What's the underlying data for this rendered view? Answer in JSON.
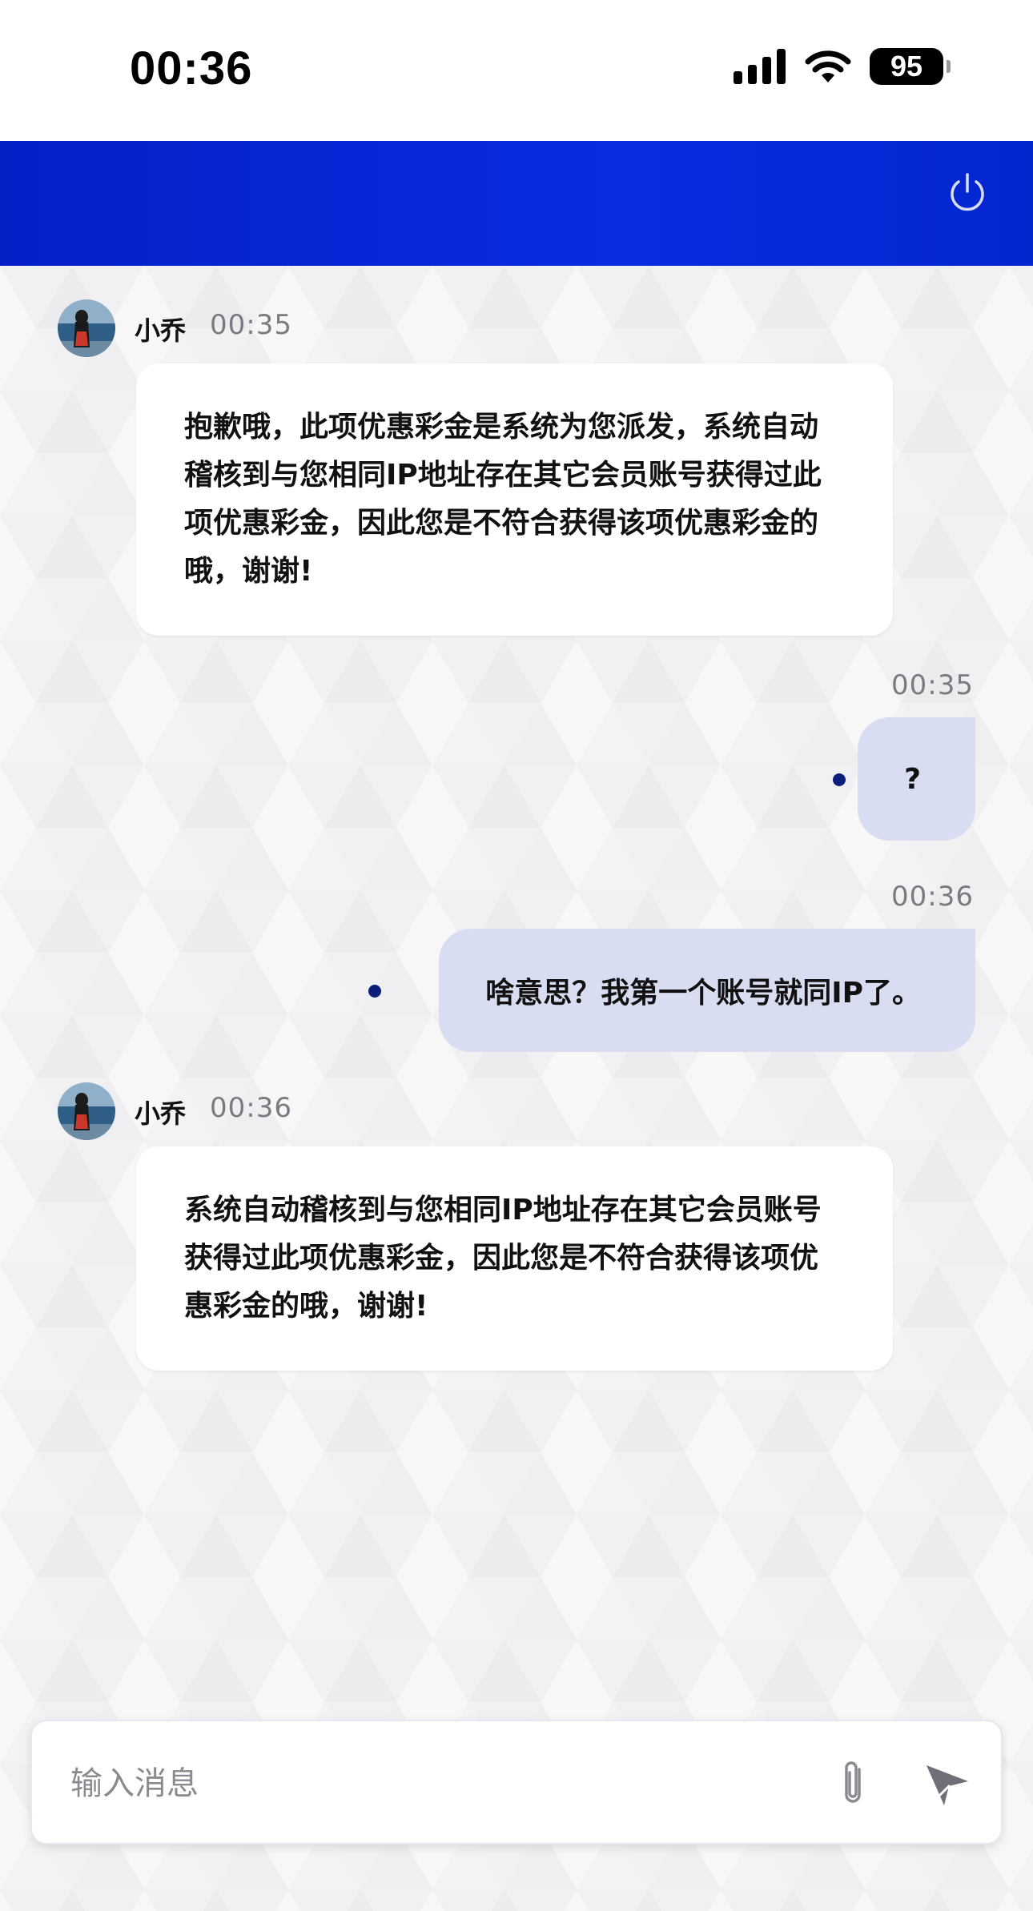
{
  "status_bar": {
    "time": "00:36",
    "battery": "95"
  },
  "header": {
    "power_icon": "power-icon"
  },
  "messages": [
    {
      "sender": "agent",
      "name": "小乔",
      "time": "00:35",
      "text": "抱歉哦，此项优惠彩金是系统为您派发，系统自动稽核到与您相同IP地址存在其它会员账号获得过此项优惠彩金，因此您是不符合获得该项优惠彩金的哦，谢谢!"
    },
    {
      "sender": "user",
      "time": "00:35",
      "text": "?"
    },
    {
      "sender": "user",
      "time": "00:36",
      "text": "啥意思？我第一个账号就同IP了。"
    },
    {
      "sender": "agent",
      "name": "小乔",
      "time": "00:36",
      "text": "系统自动稽核到与您相同IP地址存在其它会员账号获得过此项优惠彩金，因此您是不符合获得该项优惠彩金的哦，谢谢!"
    }
  ],
  "composer": {
    "placeholder": "输入消息",
    "attach_icon": "paperclip-icon",
    "send_icon": "send-icon"
  },
  "colors": {
    "header_blue": "#0a2be0",
    "user_bubble": "#d9ddf1",
    "read_dot": "#0b1f7a"
  }
}
